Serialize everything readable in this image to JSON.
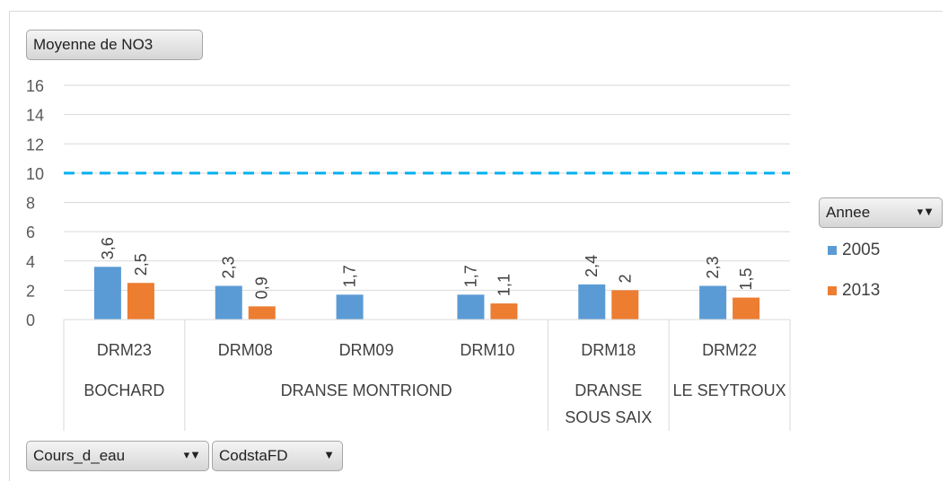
{
  "chart_data": {
    "type": "bar",
    "value_field": "Moyenne de NO3",
    "series_field": "Annee",
    "axis_fields": [
      "Cours_d_eau",
      "CodstaFD"
    ],
    "stations": [
      "DRM23",
      "DRM08",
      "DRM09",
      "DRM10",
      "DRM18",
      "DRM22"
    ],
    "rivers": [
      {
        "name": "BOCHARD",
        "lines": [
          "BOCHARD"
        ],
        "span": 1
      },
      {
        "name": "DRANSE MONTRIOND",
        "lines": [
          "DRANSE MONTRIOND"
        ],
        "span": 3
      },
      {
        "name": "DRANSE SOUS SAIX",
        "lines": [
          "DRANSE",
          "SOUS SAIX"
        ],
        "span": 1
      },
      {
        "name": "LE SEYTROUX",
        "lines": [
          "LE SEYTROUX"
        ],
        "span": 1
      }
    ],
    "series": [
      {
        "name": "2005",
        "color": "#5b9bd5",
        "values": [
          3.6,
          2.3,
          1.7,
          1.7,
          2.4,
          2.3
        ],
        "labels": [
          "3,6",
          "2,3",
          "1,7",
          "1,7",
          "2,4",
          "2,3"
        ]
      },
      {
        "name": "2013",
        "color": "#ed7d31",
        "values": [
          2.5,
          0.9,
          null,
          1.1,
          2,
          1.5
        ],
        "labels": [
          "2,5",
          "0,9",
          "",
          "1,1",
          "2",
          "1,5"
        ]
      }
    ],
    "ylim": [
      0,
      16
    ],
    "yticks": [
      0,
      2,
      4,
      6,
      8,
      10,
      12,
      14,
      16
    ],
    "reference_line": {
      "value": 10,
      "color": "#00b0f0",
      "style": "dashed"
    },
    "grid": true,
    "legend_position": "right"
  }
}
